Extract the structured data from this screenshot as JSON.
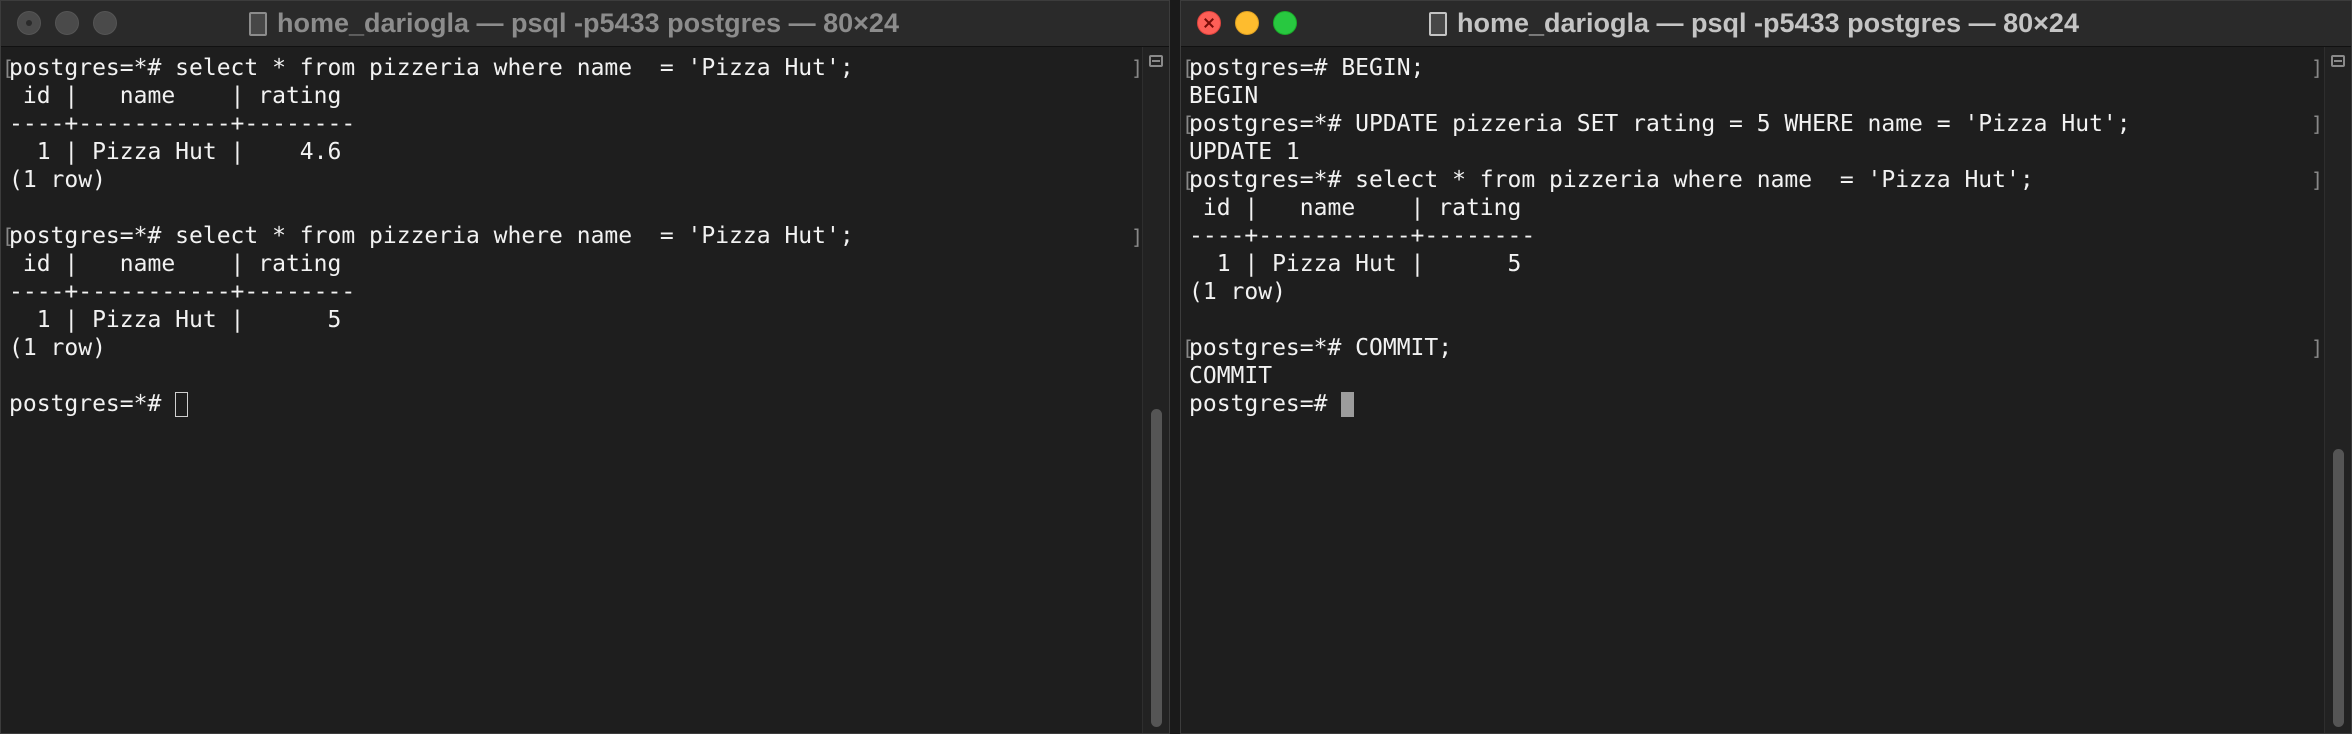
{
  "left_window": {
    "title": "home_dariogla — psql -p5433 postgres — 80×24",
    "state": "inactive",
    "lines": [
      "postgres=*# select * from pizzeria where name  = 'Pizza Hut';",
      " id |   name    | rating",
      "----+-----------+--------",
      "  1 | Pizza Hut |    4.6",
      "(1 row)",
      "",
      "postgres=*# select * from pizzeria where name  = 'Pizza Hut';",
      " id |   name    | rating",
      "----+-----------+--------",
      "  1 | Pizza Hut |      5",
      "(1 row)",
      "",
      "postgres=*# "
    ]
  },
  "right_window": {
    "title": "home_dariogla — psql -p5433 postgres — 80×24",
    "state": "active",
    "lines": [
      "postgres=# BEGIN;",
      "BEGIN",
      "postgres=*# UPDATE pizzeria SET rating = 5 WHERE name = 'Pizza Hut';",
      "UPDATE 1",
      "postgres=*# select * from pizzeria where name  = 'Pizza Hut';",
      " id |   name    | rating",
      "----+-----------+--------",
      "  1 | Pizza Hut |      5",
      "(1 row)",
      "",
      "postgres=*# COMMIT;",
      "COMMIT",
      "postgres=# "
    ]
  },
  "icons": {
    "close": "close-icon",
    "minimize": "minimize-icon",
    "zoom": "zoom-icon",
    "document": "document-icon",
    "scrollbar_menu": "scrollbar-menu-icon"
  },
  "colors": {
    "background": "#1e1e1e",
    "text": "#f2f2f2",
    "close": "#fe5f57",
    "minimize": "#febc2e",
    "zoom": "#28c840"
  }
}
